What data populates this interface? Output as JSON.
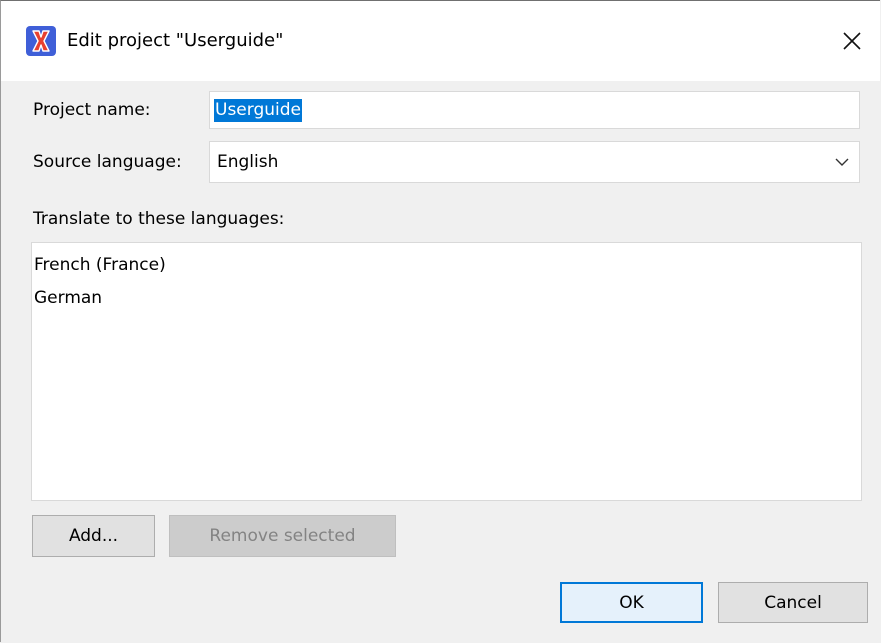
{
  "window": {
    "title": "Edit project \"Userguide\"",
    "icon": "app-x-logo-icon",
    "close_icon": "close-icon"
  },
  "form": {
    "project_name_label": "Project name:",
    "project_name_value": "Userguide",
    "source_language_label": "Source language:",
    "source_language_value": "English",
    "targets_label": "Translate to these languages:",
    "target_languages": [
      "French (France)",
      "German"
    ]
  },
  "buttons": {
    "add": "Add...",
    "remove_selected": "Remove selected",
    "ok": "OK",
    "cancel": "Cancel"
  },
  "colors": {
    "selection": "#0078d7",
    "app_icon_bg": "#3f5fd8",
    "app_icon_glyph": "#e8402f"
  }
}
